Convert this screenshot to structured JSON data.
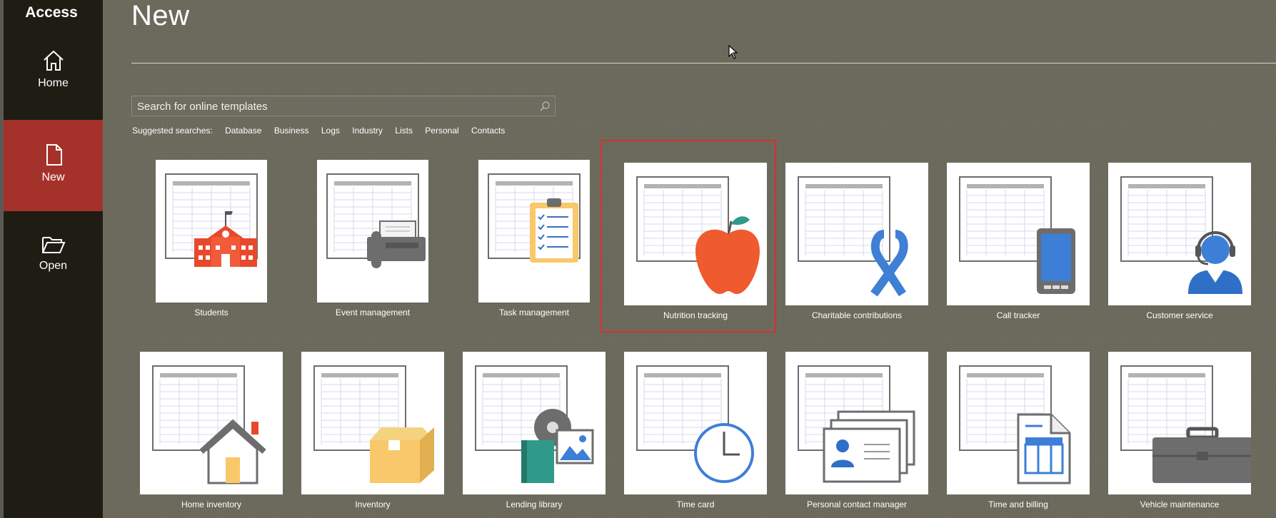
{
  "app": {
    "title": "Access"
  },
  "nav": [
    {
      "label": "Home",
      "icon": "home-icon"
    },
    {
      "label": "New",
      "icon": "new-document-icon",
      "selected": true
    },
    {
      "label": "Open",
      "icon": "folder-open-icon"
    }
  ],
  "page": {
    "title": "New"
  },
  "search": {
    "placeholder": "Search for online templates"
  },
  "suggested": {
    "label": "Suggested searches:",
    "items": [
      "Database",
      "Business",
      "Logs",
      "Industry",
      "Lists",
      "Personal",
      "Contacts"
    ]
  },
  "templates": [
    {
      "label": "Students",
      "icon": "school-building-icon"
    },
    {
      "label": "Event management",
      "icon": "fax-phone-icon"
    },
    {
      "label": "Task management",
      "icon": "clipboard-checklist-icon"
    },
    {
      "label": "Nutrition tracking",
      "icon": "apple-icon",
      "selected": true
    },
    {
      "label": "Charitable contributions",
      "icon": "ribbon-icon"
    },
    {
      "label": "Call tracker",
      "icon": "mobile-phone-icon"
    },
    {
      "label": "Customer service",
      "icon": "headset-agent-icon"
    },
    {
      "label": "Home inventory",
      "icon": "house-icon"
    },
    {
      "label": "Inventory",
      "icon": "box-icon"
    },
    {
      "label": "Lending library",
      "icon": "books-media-icon"
    },
    {
      "label": "Time card",
      "icon": "clock-icon"
    },
    {
      "label": "Personal contact manager",
      "icon": "contact-cards-icon"
    },
    {
      "label": "Time and billing",
      "icon": "invoice-document-icon"
    },
    {
      "label": "Vehicle maintenance",
      "icon": "toolbox-icon"
    }
  ],
  "colors": {
    "accent": "#a5322a",
    "selection_outline": "#d9302b",
    "sidebar": "#1f1c14",
    "background": "#6b6a5c"
  }
}
